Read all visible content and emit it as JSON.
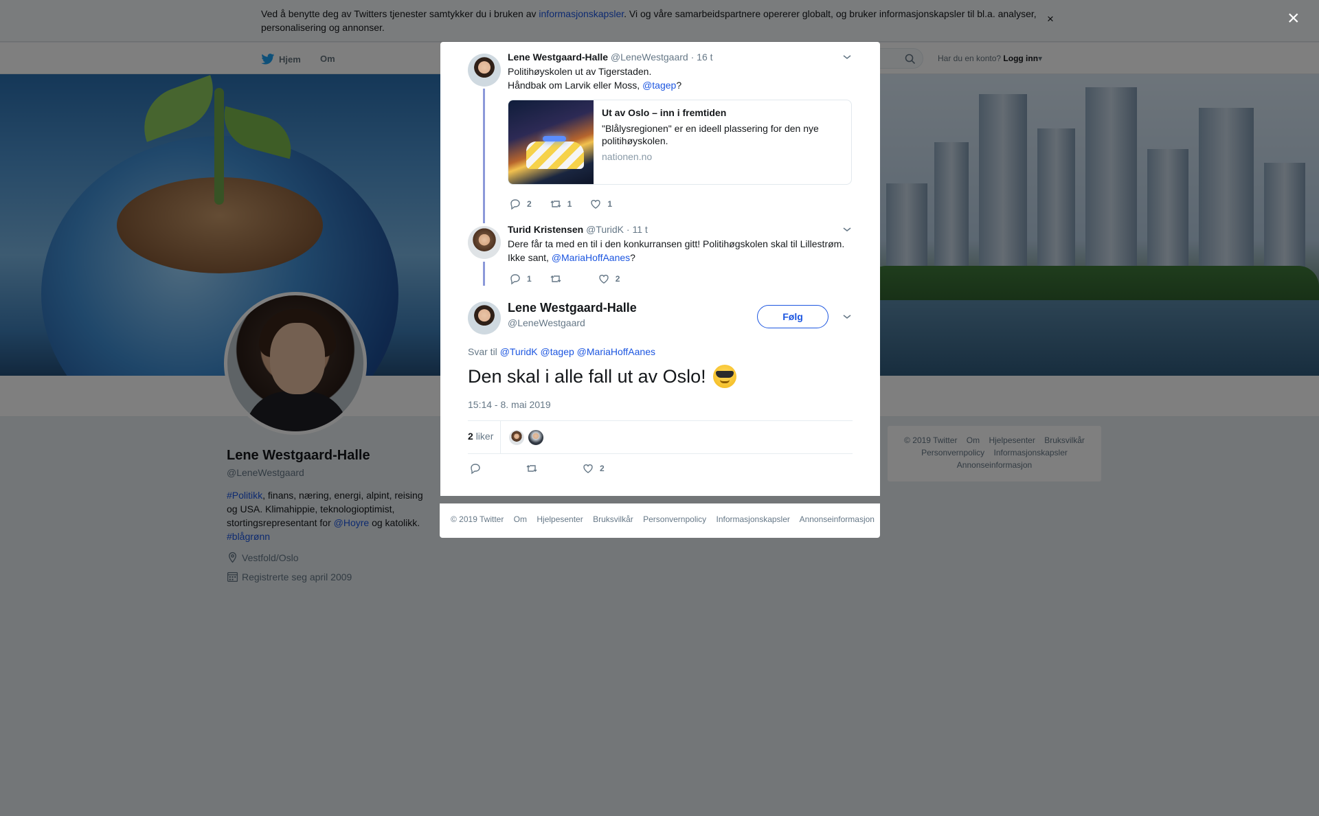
{
  "cookie": {
    "text_before": "Ved å benytte deg av Twitters tjenester samtykker du i bruken av ",
    "link": "informasjonskapsler",
    "text_after": ". Vi og våre samarbeidspartnere opererer globalt, og bruker informasjonskapsler til bl.a. analyser, personalisering og annonser.",
    "close": "×"
  },
  "nav": {
    "home": "Hjem",
    "about": "Om",
    "login_question": "Har du en konto?",
    "login": "Logg inn"
  },
  "profile": {
    "name": "Lene Westgaard-Halle",
    "handle": "@LeneWestgaard",
    "bio": {
      "tag1": "#Politikk",
      "text1": ", finans, næring, energi, alpint, reising og USA. Klimahippie, teknologioptimist, stortingsrepresentant for ",
      "mention": "@Hoyre",
      "text2": " og katolikk. ",
      "tag2": "#blågrønn"
    },
    "location": "Vestfold/Oslo",
    "joined": "Registrerte seg april 2009"
  },
  "side_footer": {
    "items": [
      "© 2019 Twitter",
      "Om",
      "Hjelpesenter",
      "Bruksvilkår",
      "Personvernpolicy",
      "Informasjonskapsler",
      "Annonseinformasjon"
    ]
  },
  "modal": {
    "close": "×",
    "tweet1": {
      "name": "Lene Westgaard-Halle",
      "handle": "@LeneWestgaard",
      "time": "· 16 t",
      "line1": "Politihøyskolen ut av Tigerstaden.",
      "line2": "Håndbak om Larvik eller Moss, ",
      "mention": "@tagep",
      "after": "?",
      "card": {
        "title": "Ut av Oslo – inn i fremtiden",
        "desc": "\"Blålysregionen\" er en ideell plassering for den nye politihøyskolen.",
        "source": "nationen.no"
      },
      "replies": "2",
      "retweets": "1",
      "likes": "1"
    },
    "tweet2": {
      "name": "Turid Kristensen",
      "handle": "@TuridK",
      "time": "· 11 t",
      "line1": "Dere får ta med en til i den konkurransen gitt! Politihøgskolen skal til Lillestrøm.",
      "line2": "Ikke sant, ",
      "mention": "@MariaHoffAanes",
      "after": "?",
      "replies": "1",
      "retweets": "",
      "likes": "2"
    },
    "main": {
      "name": "Lene Westgaard-Halle",
      "handle": "@LeneWestgaard",
      "follow": "Følg",
      "reply_label": "Svar til",
      "reply_mentions": [
        "@TuridK",
        "@tagep",
        "@MariaHoffAanes"
      ],
      "text": "Den skal i alle fall ut av Oslo!",
      "timestamp": "15:14 - 8. mai 2019",
      "likes_count": "2",
      "likes_label": "liker",
      "likes": "2"
    }
  },
  "modal_footer": {
    "items": [
      "© 2019 Twitter",
      "Om",
      "Hjelpesenter",
      "Bruksvilkår",
      "Personvernpolicy",
      "Informasjonskapsler",
      "Annonseinformasjon"
    ]
  },
  "colors": {
    "link": "#1b55e0",
    "thread_line": "#8b98d9",
    "overlay": "rgba(0,0,0,0.5)"
  }
}
